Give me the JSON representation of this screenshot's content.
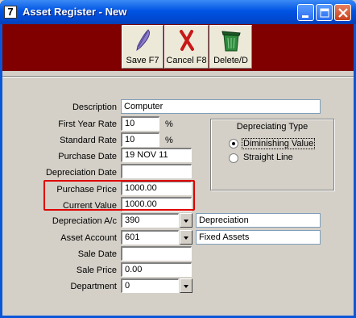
{
  "window": {
    "icon_glyph": "7",
    "title": "Asset Register - New"
  },
  "toolbar": {
    "save_label": "Save F7",
    "cancel_label": "Cancel F8",
    "delete_label": "Delete/D"
  },
  "form": {
    "description": {
      "label": "Description",
      "value": "Computer"
    },
    "first_year_rate": {
      "label": "First Year Rate",
      "value": "10",
      "unit": "%"
    },
    "standard_rate": {
      "label": "Standard Rate",
      "value": "10",
      "unit": "%"
    },
    "purchase_date": {
      "label": "Purchase Date",
      "value": "19 NOV 11"
    },
    "depreciation_date": {
      "label": "Depreciation Date",
      "value": ""
    },
    "purchase_price": {
      "label": "Purchase Price",
      "value": "1000.00"
    },
    "current_value": {
      "label": "Current Value",
      "value": "1000.00"
    },
    "depreciation_ac": {
      "label": "Depreciation A/c",
      "value": "390",
      "name": "Depreciation"
    },
    "asset_account": {
      "label": "Asset Account",
      "value": "601",
      "name": "Fixed Assets"
    },
    "sale_date": {
      "label": "Sale Date",
      "value": ""
    },
    "sale_price": {
      "label": "Sale Price",
      "value": "0.00"
    },
    "department": {
      "label": "Department",
      "value": "0"
    }
  },
  "depreciating_type": {
    "title": "Depreciating Type",
    "options": [
      {
        "label": "Diminishing Value",
        "selected": true
      },
      {
        "label": "Straight Line",
        "selected": false
      }
    ]
  },
  "colors": {
    "toolbar_bg": "#800000",
    "titlebar": "#0054e3",
    "highlight": "#e00000"
  }
}
